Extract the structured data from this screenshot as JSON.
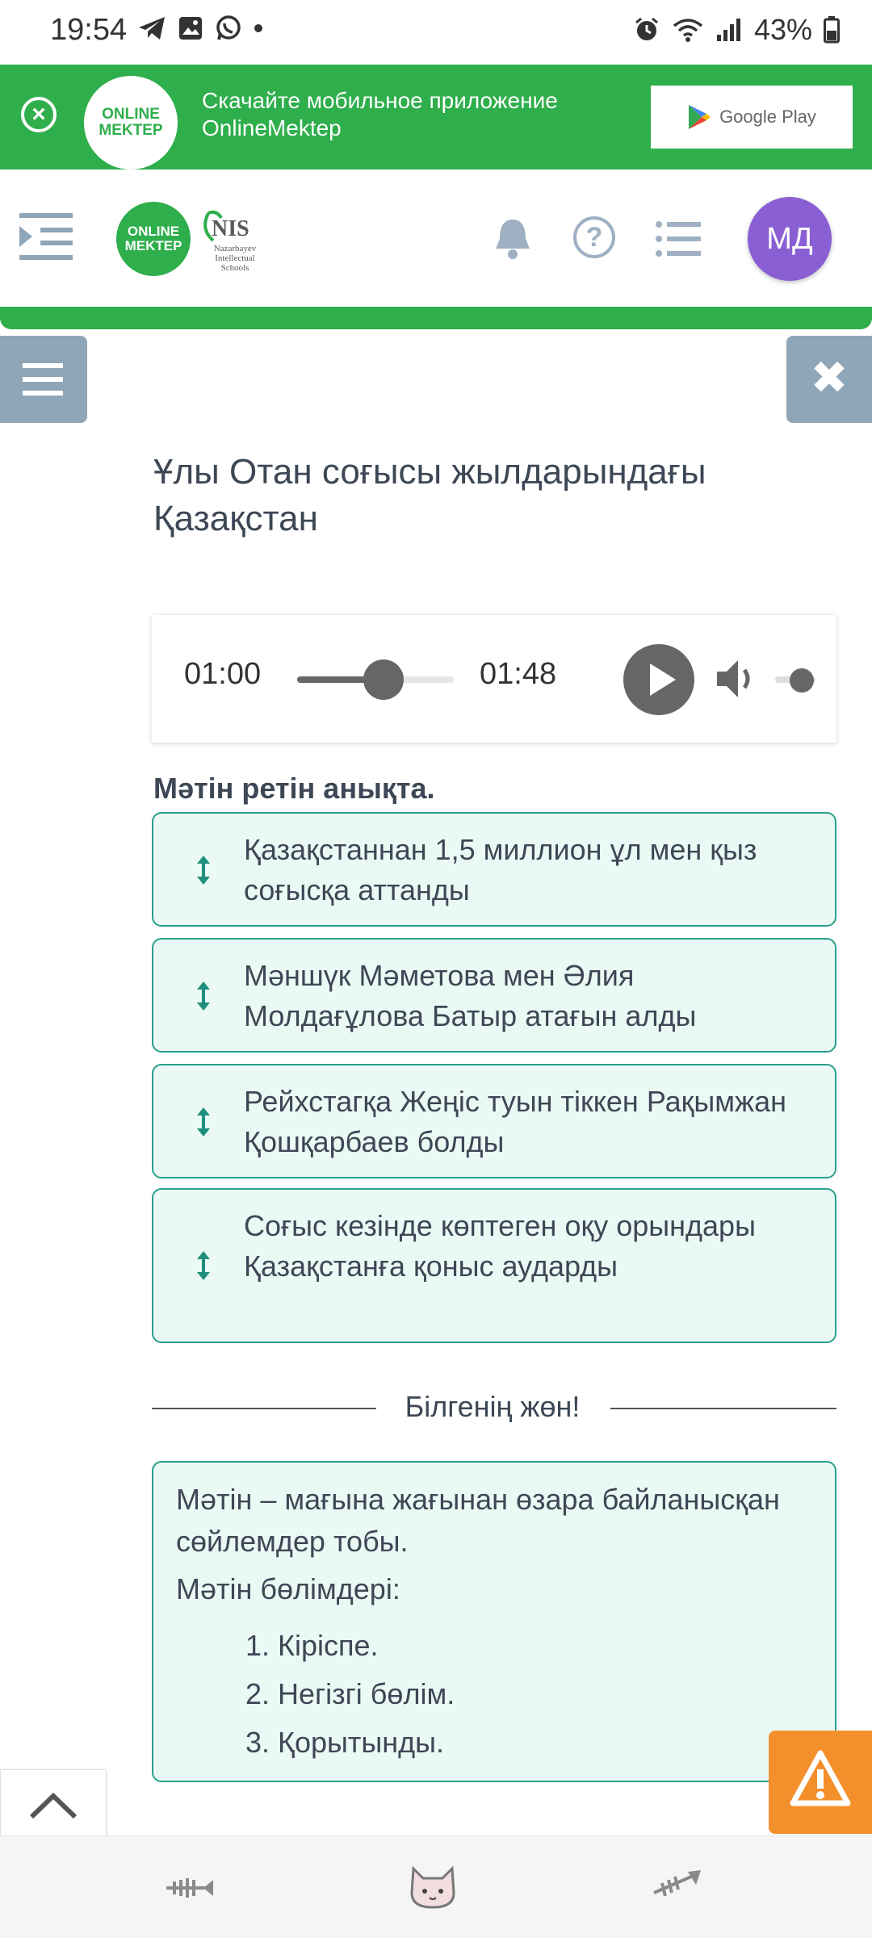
{
  "status_bar": {
    "time": "19:54",
    "battery": "43%"
  },
  "promo": {
    "logo_line1": "ONLINE",
    "logo_line2": "MEKTEP",
    "text_line1": "Скачайте мобильное приложение",
    "text_line2": "OnlineMektep",
    "store_label": "Google Play"
  },
  "header": {
    "logo_line1": "ONLINE",
    "logo_line2": "MEKTEP",
    "nis_label": "NIS",
    "nis_sub": "Nazarbayev Intellectual Schools",
    "help_symbol": "?",
    "avatar_initials": "МД"
  },
  "lesson": {
    "title": "Ұлы Отан соғысы жылдарындағы Қазақстан"
  },
  "audio": {
    "current_time": "01:00",
    "total_time": "01:48",
    "progress_fraction": 0.55
  },
  "task": {
    "instruction": "Мәтін ретін анықта.",
    "items": [
      {
        "text": "Қазақстаннан 1,5 миллион ұл мен қыз соғысқа аттанды"
      },
      {
        "text": "Мәншүк Мәметова мен Әлия Молдағұлова Батыр атағын алды"
      },
      {
        "text": "Рейхстагқа Жеңіс туын тіккен Рақымжан Қошқарбаев болды"
      },
      {
        "text": "Соғыс кезінде көптеген оқу орындары Қазақстанға қоныс аударды"
      }
    ]
  },
  "knowledge": {
    "heading": "Білгенің жөн!",
    "definition": "Мәтін – мағына жағынан өзара байланысқан сөйлемдер тобы.",
    "parts_title": "Мәтін бөлімдері:",
    "parts": [
      "1. Кіріспе.",
      "2. Негізгі бөлім.",
      "3. Қорытынды."
    ]
  },
  "colors": {
    "brand_green": "#2fae4c",
    "accent_teal": "#28a08a",
    "item_bg": "#ebf9f5",
    "avatar": "#8a5fd4",
    "warning": "#f4902b"
  },
  "icons": [
    "telegram-icon",
    "gallery-icon",
    "whatsapp-icon",
    "alarm-icon",
    "wifi-icon",
    "signal-icon",
    "battery-icon",
    "close-icon",
    "google-play-icon",
    "menu-indent-icon",
    "bell-icon",
    "help-icon",
    "list-icon",
    "hamburger-icon",
    "close-icon",
    "play-icon",
    "volume-icon",
    "drag-handle-icon",
    "chevron-up-icon",
    "warning-icon",
    "fishbone-icon",
    "cat-icon"
  ]
}
